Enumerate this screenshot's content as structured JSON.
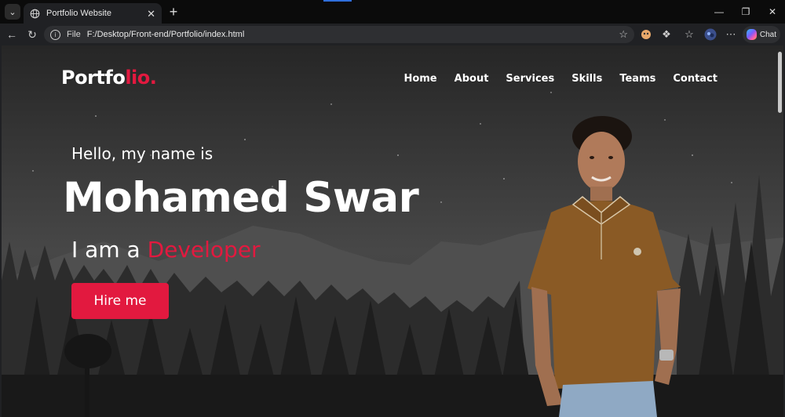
{
  "browser": {
    "tab_title": "Portfolio Website",
    "address_scheme": "File",
    "address_url": "F:/Desktop/Front-end/Portfolio/index.html",
    "chat_label": "Chat",
    "icons": {
      "tab_menu": "chevron-down-icon",
      "tab": "globe-icon",
      "tab_close": "close-icon",
      "new_tab": "plus-icon",
      "back": "back-arrow-icon",
      "reload": "reload-icon",
      "info": "info-icon",
      "favorite": "star-icon",
      "more": "more-icon"
    }
  },
  "site": {
    "logo_main": "Portfo",
    "logo_accent": "lio.",
    "nav": [
      "Home",
      "About",
      "Services",
      "Skills",
      "Teams",
      "Contact"
    ],
    "greeting": "Hello, my name is",
    "name": "Mohamed Swar",
    "role_prefix": "I am a",
    "role_word": "Developer",
    "cta": "Hire me"
  },
  "colors": {
    "accent": "#e2193f",
    "text": "#ffffff",
    "chrome": "#202124"
  }
}
